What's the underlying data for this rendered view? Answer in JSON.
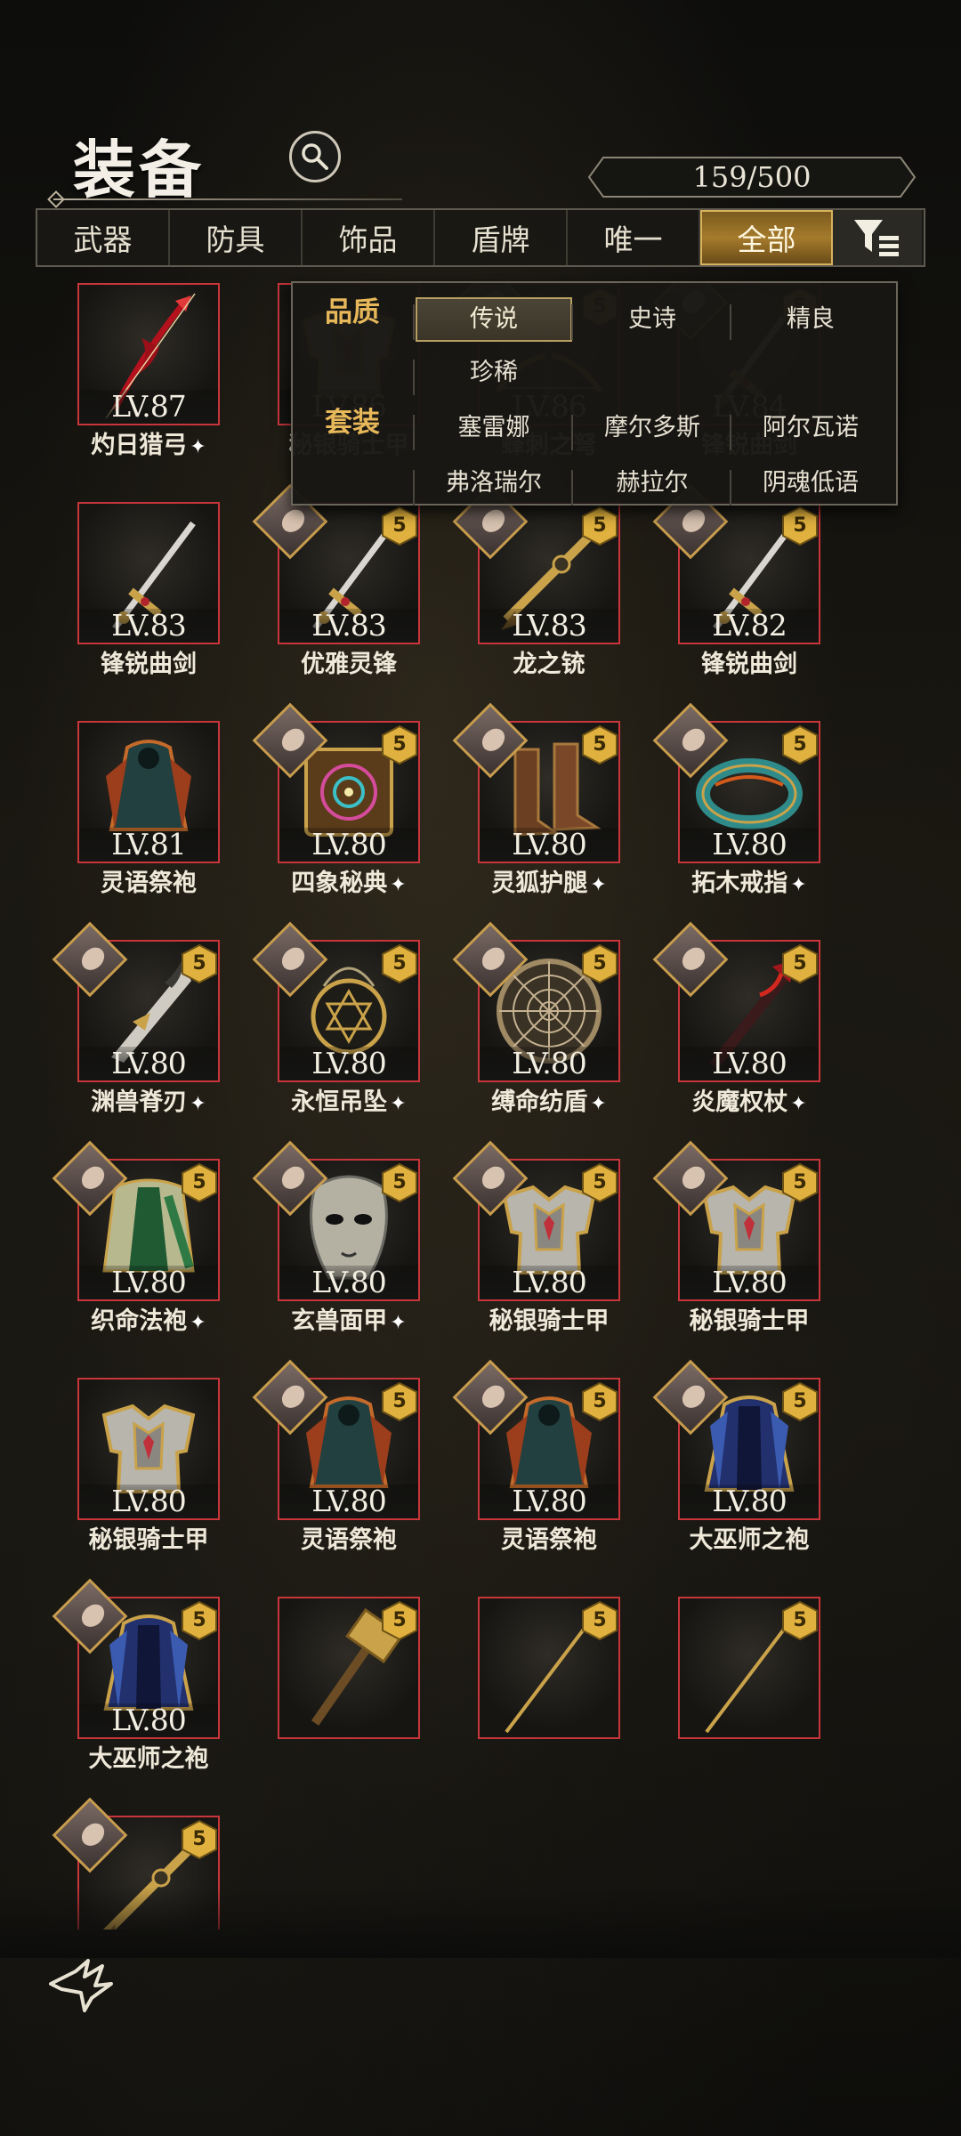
{
  "header": {
    "title": "装备",
    "count": "159/500"
  },
  "tabs": [
    {
      "label": "武器",
      "active": false
    },
    {
      "label": "防具",
      "active": false
    },
    {
      "label": "饰品",
      "active": false
    },
    {
      "label": "盾牌",
      "active": false
    },
    {
      "label": "唯一",
      "active": false
    },
    {
      "label": "全部",
      "active": true
    }
  ],
  "filter": {
    "quality_label": "品质",
    "quality_options": [
      {
        "label": "传说",
        "selected": true
      },
      {
        "label": "史诗",
        "selected": false
      },
      {
        "label": "精良",
        "selected": false
      },
      {
        "label": "珍稀",
        "selected": false
      }
    ],
    "set_label": "套装",
    "set_options": [
      {
        "label": "塞雷娜"
      },
      {
        "label": "摩尔多斯"
      },
      {
        "label": "阿尔瓦诺"
      },
      {
        "label": "弗洛瑞尔"
      },
      {
        "label": "赫拉尔"
      },
      {
        "label": "阴魂低语"
      }
    ]
  },
  "items": [
    {
      "level": "LV.87",
      "name": "灼日猎弓",
      "star": true,
      "badge": "",
      "portrait": false,
      "art": "bow-red"
    },
    {
      "level": "LV.86",
      "name": "秘银骑士甲",
      "star": false,
      "badge": "",
      "portrait": false,
      "art": "armor"
    },
    {
      "level": "LV.86",
      "name": "蜂刺之弩",
      "star": false,
      "badge": "5",
      "portrait": true,
      "art": "crossbow"
    },
    {
      "level": "LV.84",
      "name": "锋锐曲剑",
      "star": false,
      "badge": "5",
      "portrait": true,
      "art": "sword"
    },
    {
      "level": "LV.83",
      "name": "锋锐曲剑",
      "star": false,
      "badge": "",
      "portrait": false,
      "art": "sword"
    },
    {
      "level": "LV.83",
      "name": "优雅灵锋",
      "star": false,
      "badge": "5",
      "portrait": true,
      "art": "sword"
    },
    {
      "level": "LV.83",
      "name": "龙之铳",
      "star": false,
      "badge": "5",
      "portrait": true,
      "art": "gun"
    },
    {
      "level": "LV.82",
      "name": "锋锐曲剑",
      "star": false,
      "badge": "5",
      "portrait": true,
      "art": "sword"
    },
    {
      "level": "LV.81",
      "name": "灵语祭袍",
      "star": false,
      "badge": "",
      "portrait": false,
      "art": "robe-teal"
    },
    {
      "level": "LV.80",
      "name": "四象秘典",
      "star": true,
      "badge": "5",
      "portrait": true,
      "art": "book"
    },
    {
      "level": "LV.80",
      "name": "灵狐护腿",
      "star": true,
      "badge": "5",
      "portrait": true,
      "art": "boots"
    },
    {
      "level": "LV.80",
      "name": "拓木戒指",
      "star": true,
      "badge": "5",
      "portrait": true,
      "art": "ring"
    },
    {
      "level": "LV.80",
      "name": "渊兽脊刃",
      "star": true,
      "badge": "5",
      "portrait": true,
      "art": "blade"
    },
    {
      "level": "LV.80",
      "name": "永恒吊坠",
      "star": true,
      "badge": "5",
      "portrait": true,
      "art": "amulet"
    },
    {
      "level": "LV.80",
      "name": "缚命纺盾",
      "star": true,
      "badge": "5",
      "portrait": true,
      "art": "shield"
    },
    {
      "level": "LV.80",
      "name": "炎魔权杖",
      "star": true,
      "badge": "5",
      "portrait": true,
      "art": "staff"
    },
    {
      "level": "LV.80",
      "name": "织命法袍",
      "star": true,
      "badge": "5",
      "portrait": true,
      "art": "robe-green"
    },
    {
      "level": "LV.80",
      "name": "玄兽面甲",
      "star": true,
      "badge": "5",
      "portrait": true,
      "art": "mask"
    },
    {
      "level": "LV.80",
      "name": "秘银骑士甲",
      "star": false,
      "badge": "5",
      "portrait": true,
      "art": "armor"
    },
    {
      "level": "LV.80",
      "name": "秘银骑士甲",
      "star": false,
      "badge": "5",
      "portrait": true,
      "art": "armor"
    },
    {
      "level": "LV.80",
      "name": "秘银骑士甲",
      "star": false,
      "badge": "",
      "portrait": false,
      "art": "armor"
    },
    {
      "level": "LV.80",
      "name": "灵语祭袍",
      "star": false,
      "badge": "5",
      "portrait": true,
      "art": "robe-teal"
    },
    {
      "level": "LV.80",
      "name": "灵语祭袍",
      "star": false,
      "badge": "5",
      "portrait": true,
      "art": "robe-teal"
    },
    {
      "level": "LV.80",
      "name": "大巫师之袍",
      "star": false,
      "badge": "5",
      "portrait": true,
      "art": "robe-blue"
    },
    {
      "level": "LV.80",
      "name": "大巫师之袍",
      "star": false,
      "badge": "5",
      "portrait": true,
      "art": "robe-blue"
    },
    {
      "level": "",
      "name": "",
      "star": false,
      "badge": "5",
      "portrait": false,
      "art": "hammer"
    },
    {
      "level": "",
      "name": "",
      "star": false,
      "badge": "5",
      "portrait": false,
      "art": "spear"
    },
    {
      "level": "",
      "name": "",
      "star": false,
      "badge": "5",
      "portrait": false,
      "art": "spear"
    },
    {
      "level": "",
      "name": "",
      "star": false,
      "badge": "5",
      "portrait": true,
      "art": "gun"
    }
  ],
  "icons": {
    "search": "search-icon",
    "filter": "filter-icon",
    "quality_badge": "quality-badge-icon",
    "star": "sparkle-icon",
    "logo": "game-logo-icon"
  },
  "colors": {
    "item_border": "#c8353a",
    "active_tab": "#a57b2c",
    "badge_gold": "#e0b13e"
  }
}
